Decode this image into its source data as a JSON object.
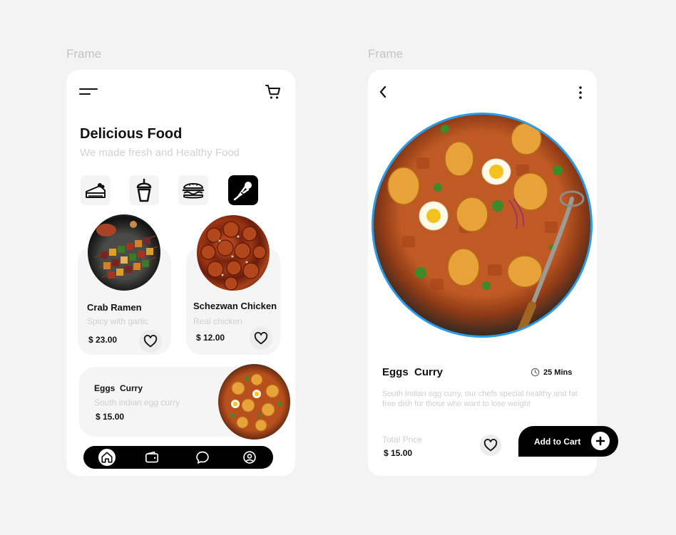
{
  "frames": [
    {
      "label": "Frame"
    },
    {
      "label": "Frame"
    }
  ],
  "home": {
    "title": "Delicious Food",
    "subtitle": "We made fresh and Healthy Food",
    "categories": [
      {
        "icon": "cake-icon"
      },
      {
        "icon": "drink-cup-icon"
      },
      {
        "icon": "burger-icon"
      },
      {
        "icon": "ice-cream-icon",
        "active": true
      }
    ],
    "items": [
      {
        "name": "Crab Ramen",
        "desc": "Spicy with garlic",
        "price": "$ 23.00"
      },
      {
        "name": "Schezwan Chicken",
        "desc": "Real chicken",
        "price": "$ 12.00"
      },
      {
        "name": "Eggs  Curry",
        "desc": "South indian egg curry",
        "price": "$ 15.00"
      }
    ],
    "nav": [
      {
        "icon": "home-icon",
        "active": true
      },
      {
        "icon": "wallet-icon"
      },
      {
        "icon": "chat-icon"
      },
      {
        "icon": "profile-icon"
      }
    ]
  },
  "detail": {
    "name": "Eggs  Curry",
    "time": "25 Mins",
    "description": "South Indian egg curry, our chefs special healthy and fat free dish for those who want to lose weight",
    "total_label": "Total Price",
    "total_price": "$ 15.00",
    "add_to_cart": "Add to Cart"
  },
  "colors": {
    "accent_ring": "#2b9be8",
    "primary": "#000000",
    "muted_text": "#cfcfcf",
    "card_bg": "#f5f5f5"
  }
}
